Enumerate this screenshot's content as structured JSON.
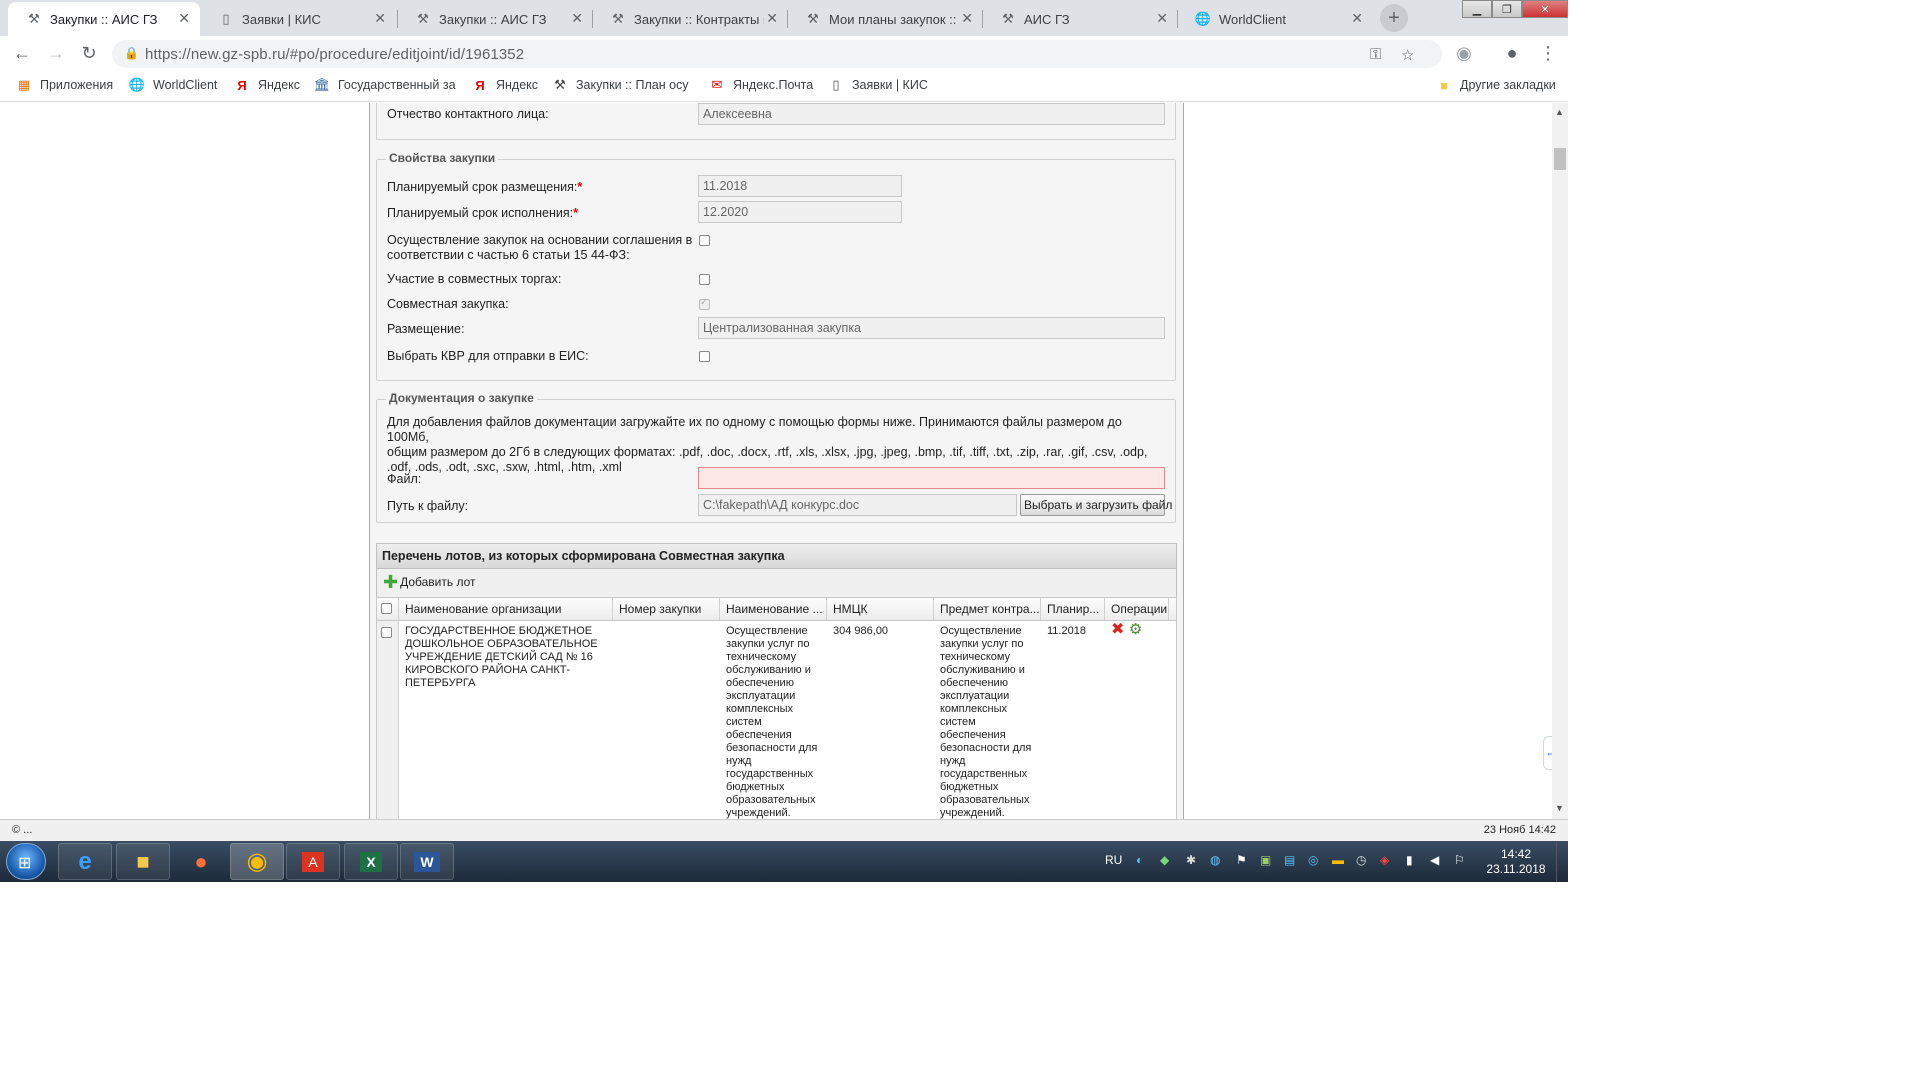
{
  "browser": {
    "tabs": [
      {
        "title": "Закупки :: АИС ГЗ",
        "icon": "tools-icon",
        "active": true
      },
      {
        "title": "Заявки | КИС",
        "icon": "page-icon",
        "active": false
      },
      {
        "title": "Закупки :: АИС ГЗ",
        "icon": "tools-icon",
        "active": false
      },
      {
        "title": "Закупки :: Контракты н",
        "icon": "tools-icon",
        "active": false
      },
      {
        "title": "Мои планы закупок :: А",
        "icon": "tools-icon",
        "active": false
      },
      {
        "title": "АИС ГЗ",
        "icon": "tools-icon",
        "active": false
      },
      {
        "title": "WorldClient",
        "icon": "globe-icon",
        "active": false
      }
    ],
    "url": "https://new.gz-spb.ru/#po/procedure/editjoint/id/1961352",
    "bookmarks": [
      {
        "label": "Приложения",
        "icon": "apps-grid-icon"
      },
      {
        "label": "WorldClient",
        "icon": "globe-icon"
      },
      {
        "label": "Яндекс",
        "icon": "yandex-icon"
      },
      {
        "label": "Государственный за",
        "icon": "gov-icon"
      },
      {
        "label": "Яндекс",
        "icon": "yandex-icon"
      },
      {
        "label": "Закупки :: План осу",
        "icon": "tools-icon"
      },
      {
        "label": "Яндекс.Почта",
        "icon": "mail-icon"
      },
      {
        "label": "Заявки | КИС",
        "icon": "page-icon"
      }
    ],
    "other_bookmarks": "Другие закладки"
  },
  "form": {
    "contact_patronymic": {
      "label": "Отчество контактного лица:",
      "value": "Алексеевна"
    },
    "props_legend": "Свойства закупки",
    "placement_date": {
      "label": "Планируемый срок размещения:",
      "value": "11.2018",
      "required": "*"
    },
    "execution_date": {
      "label": "Планируемый срок исполнения:",
      "value": "12.2020",
      "required": "*"
    },
    "agreement": {
      "label_line1": "Осуществление закупок на основании соглашения в",
      "label_line2": "соответствии с частью 6 статьи 15 44-ФЗ:",
      "checked": false
    },
    "joint_tenders": {
      "label": "Участие в совместных торгах:",
      "checked": false
    },
    "joint_purchase": {
      "label": "Совместная закупка:",
      "checked": true
    },
    "placement": {
      "label": "Размещение:",
      "value": "Централизованная закупка"
    },
    "kvr": {
      "label": "Выбрать КВР для отправки в ЕИС:",
      "checked": false
    },
    "docs_legend": "Документация о закупке",
    "docs_desc_line1": "Для добавления файлов документации загружайте их по одному с помощью формы ниже. Принимаются файлы размером до 100Мб,",
    "docs_desc_line2": "общим размером до 2Гб в следующих форматах: .pdf, .doc, .docx, .rtf, .xls, .xlsx, .jpg, .jpeg, .bmp, .tif, .tiff, .txt, .zip, .rar, .gif, .csv, .odp,",
    "docs_desc_line3": ".odf, .ods, .odt, .sxc, .sxw, .html, .htm, .xml",
    "file": {
      "label": "Файл:",
      "value": ""
    },
    "path": {
      "label": "Путь к файлу:",
      "value": "C:\\fakepath\\АД конкурс.doc"
    },
    "upload_button": "Выбрать и загрузить файл"
  },
  "lots": {
    "title": "Перечень лотов, из которых сформирована Совместная закупка",
    "add_button": "Добавить лот",
    "columns": [
      "Наименование организации",
      "Номер закупки",
      "Наименование ...",
      "НМЦК",
      "Предмет контра...",
      "Планир...",
      "Операции"
    ],
    "rows": [
      {
        "org_lines": [
          "ГОСУДАРСТВЕННОЕ БЮДЖЕТНОЕ",
          "ДОШКОЛЬНОЕ ОБРАЗОВАТЕЛЬНОЕ",
          "УЧРЕЖДЕНИЕ ДЕТСКИЙ САД № 16",
          "КИРОВСКОГО РАЙОНА САНКТ-",
          "ПЕТЕРБУРГА"
        ],
        "number": "",
        "name_lines": [
          "Осуществление",
          "закупки услуг по",
          "техническому",
          "обслуживанию и",
          "обеспечению",
          "эксплуатации",
          "комплексных",
          "систем",
          "обеспечения",
          "безопасности для",
          "нужд",
          "государственных",
          "бюджетных",
          "образовательных",
          "учреждений."
        ],
        "nmck": "304 986,00",
        "subject_lines": [
          "Осуществление",
          "закупки услуг по",
          "техническому",
          "обслуживанию и",
          "обеспечению",
          "эксплуатации",
          "комплексных",
          "систем",
          "обеспечения",
          "безопасности для",
          "нужд",
          "государственных",
          "бюджетных",
          "образовательных",
          "учреждений."
        ],
        "planned": "11.2018"
      }
    ]
  },
  "status": {
    "left": "© ...",
    "right": "23 Нояб 14:42"
  },
  "taskbar": {
    "lang": "RU",
    "time": "14:42",
    "date": "23.11.2018"
  }
}
